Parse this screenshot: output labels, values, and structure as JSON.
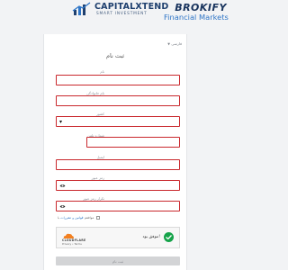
{
  "header": {
    "capital_logo": {
      "name": "CAPITALXTEND",
      "tagline": "SMART INVESTMENT"
    },
    "brokify_logo": {
      "name": "BROKIFY",
      "tagline": "Financial Markets"
    }
  },
  "language": {
    "selected": "فارسی"
  },
  "form": {
    "title": "ثبت نام",
    "fields": [
      {
        "label": "نام",
        "value": ""
      },
      {
        "label": "نام خانوادگی",
        "value": ""
      },
      {
        "label": "کشور",
        "value": ""
      },
      {
        "label": "شماره تلفن",
        "value": ""
      },
      {
        "label": "ایمیل",
        "value": ""
      },
      {
        "label": "رمز عبور",
        "value": ""
      },
      {
        "label": "تکرار رمز عبور",
        "value": ""
      }
    ],
    "terms": {
      "prefix": "با",
      "link": "قوانین و مقررات",
      "suffix": "موافقم"
    },
    "captcha": {
      "status": "موفق بود!",
      "brand": "CLOUDFLARE",
      "links": "Privacy • Terms"
    },
    "submit_label": "ثبت نام"
  },
  "colors": {
    "error_border": "#c9282d",
    "success": "#16a34a",
    "link": "#2e75c7"
  }
}
